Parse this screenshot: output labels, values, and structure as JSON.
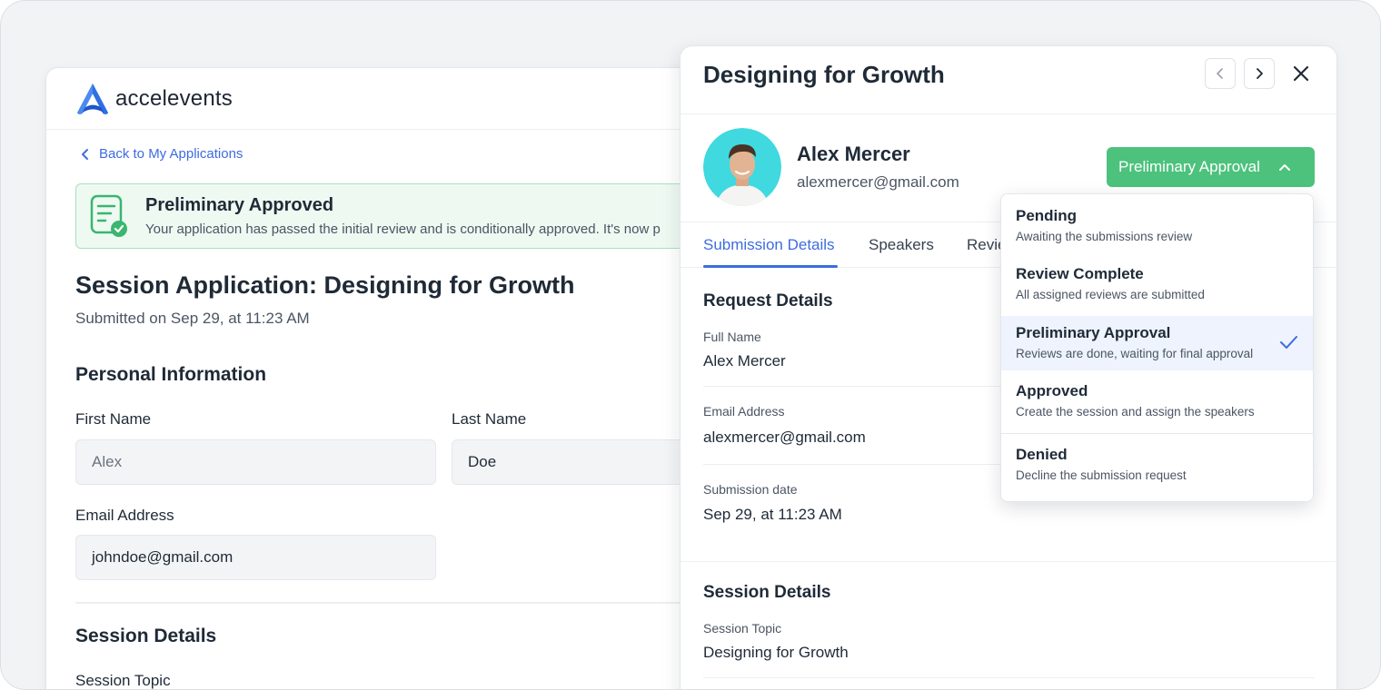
{
  "app": {
    "brand_name": "accelevents",
    "back_link": "Back to My Applications",
    "alert": {
      "title": "Preliminary Approved",
      "text": "Your application has passed the initial review and is conditionally approved. It's now p"
    },
    "page_title": "Session Application: Designing for Growth",
    "submitted": "Submitted on Sep 29, at 11:23 AM",
    "personal_info": {
      "title": "Personal Information",
      "first_name_label": "First Name",
      "first_name_value": "Alex",
      "last_name_label": "Last Name",
      "last_name_value": "Doe",
      "email_label": "Email Address",
      "email_value": "johndoe@gmail.com"
    },
    "session_details": {
      "title": "Session Details",
      "topic_label": "Session Topic"
    }
  },
  "panel": {
    "title": "Designing for Growth",
    "user": {
      "name": "Alex Mercer",
      "email": "alexmercer@gmail.com"
    },
    "status_button": "Preliminary Approval",
    "tabs": [
      "Submission Details",
      "Speakers",
      "Revie"
    ],
    "request_details": {
      "title": "Request Details",
      "full_name_label": "Full Name",
      "full_name_value": "Alex Mercer",
      "email_label": "Email Address",
      "email_value": "alexmercer@gmail.com",
      "date_label": "Submission date",
      "date_value": "Sep 29, at 11:23 AM"
    },
    "session_details": {
      "title": "Session Details",
      "topic_label": "Session Topic",
      "topic_value": "Designing for Growth"
    }
  },
  "status_menu": {
    "options": [
      {
        "title": "Pending",
        "desc": "Awaiting the submissions review"
      },
      {
        "title": "Review Complete",
        "desc": "All assigned reviews are submitted"
      },
      {
        "title": "Preliminary Approval",
        "desc": "Reviews are done, waiting for final approval"
      },
      {
        "title": "Approved",
        "desc": "Create the session and assign the speakers"
      },
      {
        "title": "Denied",
        "desc": "Decline the submission request"
      }
    ],
    "selected": "Preliminary Approval"
  },
  "colors": {
    "accent_blue": "#3d6ce0",
    "success_green": "#4cc27c",
    "alert_bg": "#eef9f2",
    "selected_bg": "#eef3fd"
  }
}
